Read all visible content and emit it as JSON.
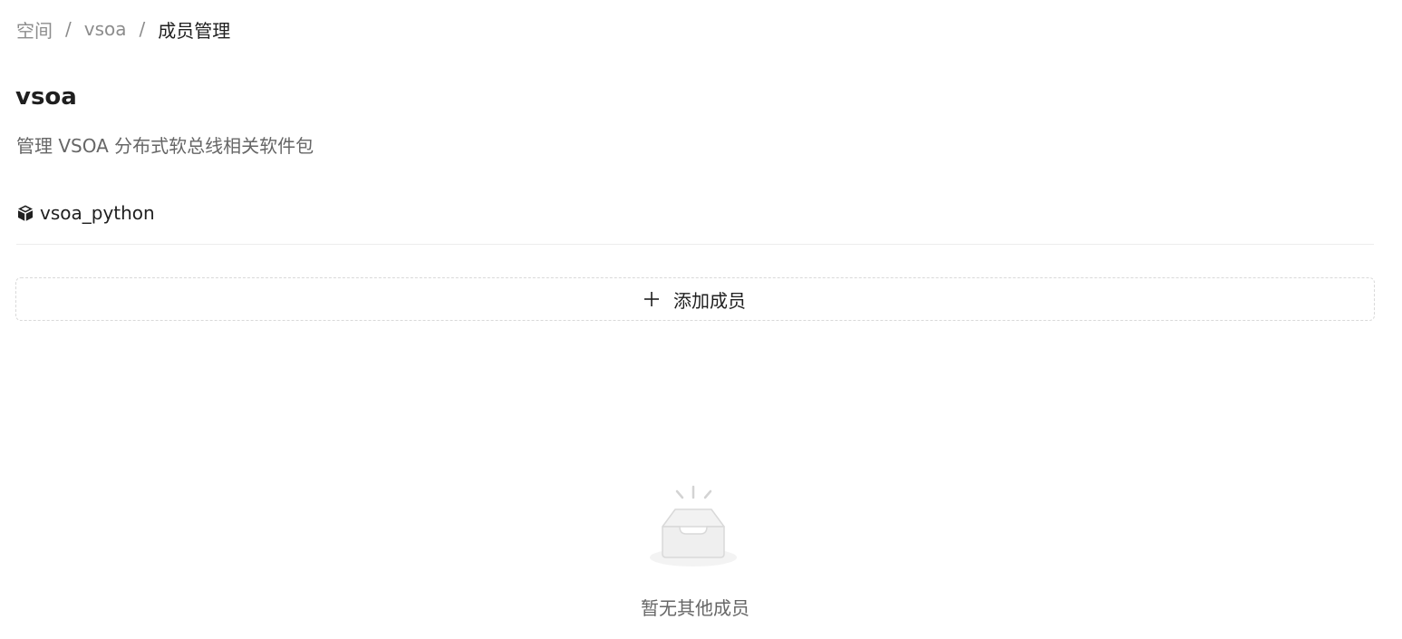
{
  "breadcrumb": {
    "items": [
      "空间",
      "vsoa"
    ],
    "separator": "/",
    "current": "成员管理"
  },
  "header": {
    "title": "vsoa",
    "description": "管理 VSOA 分布式软总线相关软件包"
  },
  "package": {
    "icon": "package-cube-icon",
    "name": "vsoa_python"
  },
  "add_member": {
    "icon": "plus-icon",
    "label": "添加成员"
  },
  "empty_state": {
    "icon": "empty-inbox-icon",
    "text": "暂无其他成员"
  }
}
